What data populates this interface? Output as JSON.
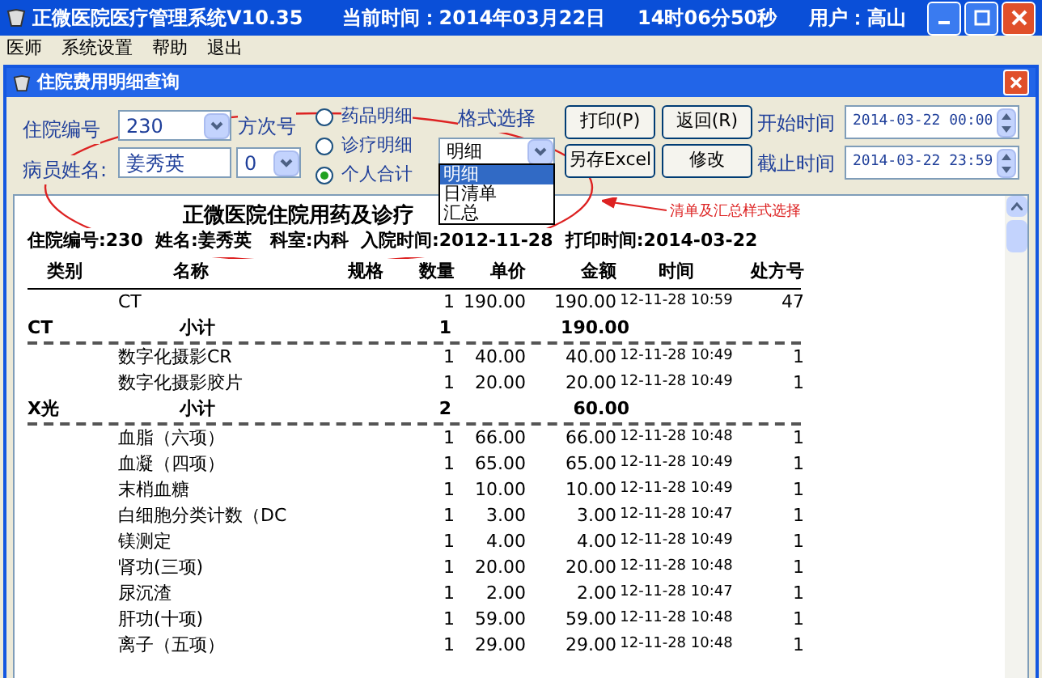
{
  "window": {
    "title": "正微医院医疗管理系统V10.35",
    "current_time": "当前时间：2014年03月22日",
    "clock": "14时06分50秒",
    "user": "用户：高山"
  },
  "menu": [
    "医师",
    "系统设置",
    "帮助",
    "退出"
  ],
  "dialog": {
    "title": "住院费用明细查询"
  },
  "form": {
    "admission_no_label": "住院编号",
    "admission_no": "230",
    "visit_no_label": "方次号",
    "patient_name_label": "病员姓名:",
    "patient_name": "姜秀英",
    "visit_no": "0",
    "radios": [
      {
        "label": "药品明细",
        "selected": false
      },
      {
        "label": "诊疗明细",
        "selected": false
      },
      {
        "label": "个人合计",
        "selected": true
      }
    ],
    "format_label": "格式选择",
    "format_value": "明细",
    "format_options": [
      {
        "label": "明细",
        "selected": true
      },
      {
        "label": "日清单",
        "selected": false
      },
      {
        "label": "汇总",
        "selected": false
      }
    ],
    "buttons": [
      "打印(P)",
      "返回(R)",
      "另存Excel",
      "修改"
    ],
    "start_label": "开始时间",
    "start_value": "2014-03-22 00:00",
    "end_label": "截止时间",
    "end_value": "2014-03-22 23:59"
  },
  "annotation": {
    "text": "清单及汇总样式选择"
  },
  "report": {
    "title": "正微医院住院用药及诊疗",
    "info": "住院编号:230  姓名:姜秀英   科室:内科  入院时间:2012-11-28  打印时间:2014-03-22",
    "columns": [
      "类别",
      "名称",
      "规格",
      "数量",
      "单价",
      "金额",
      "时间",
      "处方号"
    ],
    "rows": [
      {
        "kind": "item",
        "name": "CT",
        "qty": "1",
        "price": "190.00",
        "amount": "190.00",
        "time": "12-11-28 10:59",
        "rx": "47"
      },
      {
        "kind": "subtotal",
        "category": "CT",
        "label": "小计",
        "qty": "1",
        "amount": "190.00"
      },
      {
        "kind": "item",
        "name": "数字化摄影CR",
        "qty": "1",
        "price": "40.00",
        "amount": "40.00",
        "time": "12-11-28 10:49",
        "rx": "1"
      },
      {
        "kind": "item",
        "name": "数字化摄影胶片",
        "qty": "1",
        "price": "20.00",
        "amount": "20.00",
        "time": "12-11-28 10:49",
        "rx": "1"
      },
      {
        "kind": "subtotal",
        "category": "X光",
        "label": "小计",
        "qty": "2",
        "amount": "60.00"
      },
      {
        "kind": "item",
        "name": "血脂（六项）",
        "qty": "1",
        "price": "66.00",
        "amount": "66.00",
        "time": "12-11-28 10:48",
        "rx": "1"
      },
      {
        "kind": "item",
        "name": "血凝（四项）",
        "qty": "1",
        "price": "65.00",
        "amount": "65.00",
        "time": "12-11-28 10:49",
        "rx": "1"
      },
      {
        "kind": "item",
        "name": "末梢血糖",
        "qty": "1",
        "price": "10.00",
        "amount": "10.00",
        "time": "12-11-28 10:49",
        "rx": "1"
      },
      {
        "kind": "item",
        "name": "白细胞分类计数（DC",
        "qty": "1",
        "price": "3.00",
        "amount": "3.00",
        "time": "12-11-28 10:47",
        "rx": "1"
      },
      {
        "kind": "item",
        "name": "镁测定",
        "qty": "1",
        "price": "4.00",
        "amount": "4.00",
        "time": "12-11-28 10:49",
        "rx": "1"
      },
      {
        "kind": "item",
        "name": "肾功(三项)",
        "qty": "1",
        "price": "20.00",
        "amount": "20.00",
        "time": "12-11-28 10:48",
        "rx": "1"
      },
      {
        "kind": "item",
        "name": "尿沉渣",
        "qty": "1",
        "price": "2.00",
        "amount": "2.00",
        "time": "12-11-28 10:47",
        "rx": "1"
      },
      {
        "kind": "item",
        "name": "肝功(十项)",
        "qty": "1",
        "price": "59.00",
        "amount": "59.00",
        "time": "12-11-28 10:48",
        "rx": "1"
      },
      {
        "kind": "item",
        "name": "离子（五项）",
        "qty": "1",
        "price": "29.00",
        "amount": "29.00",
        "time": "12-11-28 10:48",
        "rx": "1"
      }
    ]
  }
}
